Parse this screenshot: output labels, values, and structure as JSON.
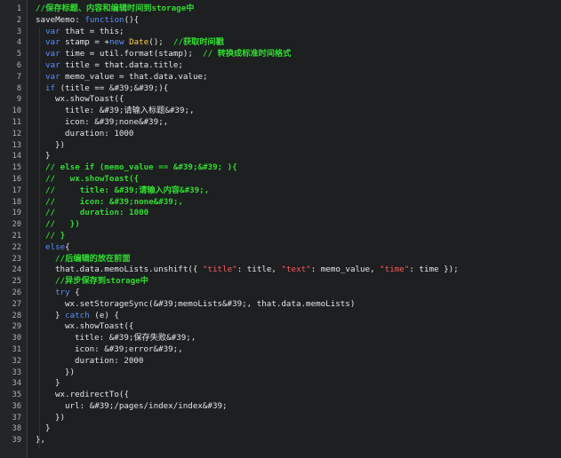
{
  "colors": {
    "background": "#1d1f21",
    "gutter": "#232529",
    "keyword": "#5b8cff",
    "comment": "#2fdc2f",
    "string": "#ff5a5a",
    "class": "#ffd24a",
    "text": "#e6e6e6"
  },
  "lines": [
    {
      "n": "1",
      "i": 0,
      "t": [
        {
          "c": "cm",
          "v": "//保存标题、内容和编辑时间到storage中"
        }
      ]
    },
    {
      "n": "2",
      "i": 0,
      "t": [
        {
          "c": "p",
          "v": "saveMemo: "
        },
        {
          "c": "kw",
          "v": "function"
        },
        {
          "c": "p",
          "v": "(){"
        }
      ]
    },
    {
      "n": "3",
      "i": 1,
      "t": [
        {
          "c": "kw",
          "v": "var"
        },
        {
          "c": "p",
          "v": " that = this;"
        }
      ]
    },
    {
      "n": "4",
      "i": 1,
      "t": [
        {
          "c": "kw",
          "v": "var"
        },
        {
          "c": "p",
          "v": " stamp = +"
        },
        {
          "c": "kw",
          "v": "new"
        },
        {
          "c": "p",
          "v": " "
        },
        {
          "c": "cls",
          "v": "Date"
        },
        {
          "c": "p",
          "v": "();  "
        },
        {
          "c": "cm",
          "v": "//获取时间戳"
        }
      ]
    },
    {
      "n": "5",
      "i": 1,
      "t": [
        {
          "c": "kw",
          "v": "var"
        },
        {
          "c": "p",
          "v": " time = util.format(stamp);  "
        },
        {
          "c": "cm",
          "v": "// 转换成标准时间格式"
        }
      ]
    },
    {
      "n": "6",
      "i": 1,
      "t": [
        {
          "c": "kw",
          "v": "var"
        },
        {
          "c": "p",
          "v": " title = that.data.title;"
        }
      ]
    },
    {
      "n": "7",
      "i": 1,
      "t": [
        {
          "c": "kw",
          "v": "var"
        },
        {
          "c": "p",
          "v": " memo_value = that.data.value;"
        }
      ]
    },
    {
      "n": "8",
      "i": 1,
      "t": [
        {
          "c": "kw",
          "v": "if"
        },
        {
          "c": "p",
          "v": " (title == &#39;&#39;){"
        }
      ]
    },
    {
      "n": "9",
      "i": 2,
      "t": [
        {
          "c": "p",
          "v": "wx.showToast({"
        }
      ]
    },
    {
      "n": "10",
      "i": 3,
      "t": [
        {
          "c": "p",
          "v": "title: &#39;请输入标题&#39;,"
        }
      ]
    },
    {
      "n": "11",
      "i": 3,
      "t": [
        {
          "c": "p",
          "v": "icon: &#39;none&#39;,"
        }
      ]
    },
    {
      "n": "12",
      "i": 3,
      "t": [
        {
          "c": "p",
          "v": "duration: 1000"
        }
      ]
    },
    {
      "n": "13",
      "i": 2,
      "t": [
        {
          "c": "p",
          "v": "})"
        }
      ]
    },
    {
      "n": "14",
      "i": 1,
      "t": [
        {
          "c": "p",
          "v": "}"
        }
      ]
    },
    {
      "n": "15",
      "i": 1,
      "t": [
        {
          "c": "cm",
          "v": "// else if (memo_value == &#39;&#39; ){"
        }
      ]
    },
    {
      "n": "16",
      "i": 1,
      "t": [
        {
          "c": "cm",
          "v": "//   wx.showToast({"
        }
      ]
    },
    {
      "n": "17",
      "i": 1,
      "t": [
        {
          "c": "cm",
          "v": "//     title: &#39;请输入内容&#39;,"
        }
      ]
    },
    {
      "n": "18",
      "i": 1,
      "t": [
        {
          "c": "cm",
          "v": "//     icon: &#39;none&#39;,"
        }
      ]
    },
    {
      "n": "19",
      "i": 1,
      "t": [
        {
          "c": "cm",
          "v": "//     duration: 1000"
        }
      ]
    },
    {
      "n": "20",
      "i": 1,
      "t": [
        {
          "c": "cm",
          "v": "//   })"
        }
      ]
    },
    {
      "n": "21",
      "i": 1,
      "t": [
        {
          "c": "cm",
          "v": "// }"
        }
      ]
    },
    {
      "n": "22",
      "i": 1,
      "t": [
        {
          "c": "kw",
          "v": "else"
        },
        {
          "c": "p",
          "v": "{"
        }
      ]
    },
    {
      "n": "23",
      "i": 2,
      "t": [
        {
          "c": "cm",
          "v": "//后编辑的放在前面"
        }
      ]
    },
    {
      "n": "24",
      "i": 2,
      "t": [
        {
          "c": "p",
          "v": "that.data.memoLists.unshift({ "
        },
        {
          "c": "str",
          "v": "\"title\""
        },
        {
          "c": "p",
          "v": ": title, "
        },
        {
          "c": "str",
          "v": "\"text\""
        },
        {
          "c": "p",
          "v": ": memo_value, "
        },
        {
          "c": "str",
          "v": "\"time\""
        },
        {
          "c": "p",
          "v": ": time });"
        }
      ]
    },
    {
      "n": "25",
      "i": 2,
      "t": [
        {
          "c": "cm",
          "v": "//异步保存到storage中"
        }
      ]
    },
    {
      "n": "26",
      "i": 2,
      "t": [
        {
          "c": "kw",
          "v": "try"
        },
        {
          "c": "p",
          "v": " {"
        }
      ]
    },
    {
      "n": "27",
      "i": 3,
      "t": [
        {
          "c": "p",
          "v": "wx.setStorageSync(&#39;memoLists&#39;, that.data.memoLists)"
        }
      ]
    },
    {
      "n": "28",
      "i": 2,
      "t": [
        {
          "c": "p",
          "v": "} "
        },
        {
          "c": "kw",
          "v": "catch"
        },
        {
          "c": "p",
          "v": " (e) {"
        }
      ]
    },
    {
      "n": "29",
      "i": 3,
      "t": [
        {
          "c": "p",
          "v": "wx.showToast({"
        }
      ]
    },
    {
      "n": "30",
      "i": 4,
      "t": [
        {
          "c": "p",
          "v": "title: &#39;保存失败&#39;,"
        }
      ]
    },
    {
      "n": "31",
      "i": 4,
      "t": [
        {
          "c": "p",
          "v": "icon: &#39;error&#39;,"
        }
      ]
    },
    {
      "n": "32",
      "i": 4,
      "t": [
        {
          "c": "p",
          "v": "duration: 2000"
        }
      ]
    },
    {
      "n": "33",
      "i": 3,
      "t": [
        {
          "c": "p",
          "v": "})"
        }
      ]
    },
    {
      "n": "34",
      "i": 2,
      "t": [
        {
          "c": "p",
          "v": "}"
        }
      ]
    },
    {
      "n": "35",
      "i": 2,
      "t": [
        {
          "c": "p",
          "v": "wx.redirectTo({"
        }
      ]
    },
    {
      "n": "36",
      "i": 3,
      "t": [
        {
          "c": "p",
          "v": "url: &#39;/pages/index/index&#39;"
        }
      ]
    },
    {
      "n": "37",
      "i": 2,
      "t": [
        {
          "c": "p",
          "v": "})"
        }
      ]
    },
    {
      "n": "38",
      "i": 1,
      "t": [
        {
          "c": "p",
          "v": "}"
        }
      ]
    },
    {
      "n": "39",
      "i": 0,
      "t": [
        {
          "c": "p",
          "v": "},"
        }
      ]
    }
  ]
}
